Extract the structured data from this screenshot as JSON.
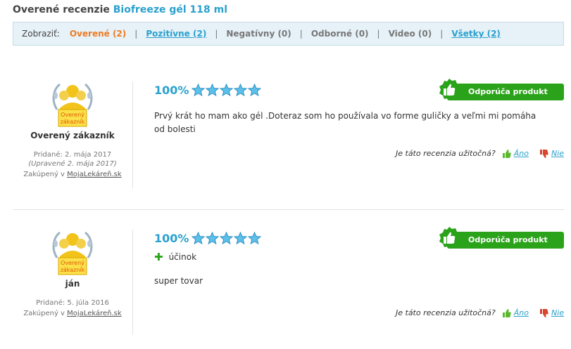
{
  "header": {
    "title_prefix": "Overené recenzie",
    "product_name": "Biofreeze gél 118 ml"
  },
  "filters": {
    "label": "Zobraziť:",
    "items": [
      {
        "label": "Overené (2)",
        "state": "active"
      },
      {
        "label": "Pozitívne (2)",
        "state": "link"
      },
      {
        "label": "Negatívny (0)",
        "state": "disabled"
      },
      {
        "label": "Odborné (0)",
        "state": "disabled"
      },
      {
        "label": "Video (0)",
        "state": "disabled"
      },
      {
        "label": "Všetky (2)",
        "state": "link"
      }
    ],
    "separator": "|"
  },
  "badge": {
    "line1": "Overený",
    "line2": "zákazník"
  },
  "reviews": [
    {
      "author": "Overený zákazník",
      "added": "Pridané: 2. mája 2017",
      "edited": "(Upravené 2. mája 2017)",
      "bought_prefix": "Zakúpený v",
      "store": "MojaLekáreň.sk",
      "score": "100%",
      "stars": 5,
      "recommend": "Odporúča produkt",
      "pros": [],
      "text": "Prvý krát ho mam ako gél .Doteraz som ho používala vo forme guličky a veľmi mi pomáha od bolesti",
      "helpful_question": "Je táto recenzia užitočná?",
      "yes": "Áno",
      "no": "Nie"
    },
    {
      "author": "ján",
      "added": "Pridané: 5. júla 2016",
      "edited": "",
      "bought_prefix": "Zakúpený v",
      "store": "MojaLekáreň.sk",
      "score": "100%",
      "stars": 5,
      "recommend": "Odporúča produkt",
      "pros": [
        "účinok"
      ],
      "text": "super tovar",
      "helpful_question": "Je táto recenzia užitočná?",
      "yes": "Áno",
      "no": "Nie"
    }
  ],
  "colors": {
    "accent_blue": "#2aa1cd",
    "active_orange": "#f07a22",
    "recommend_green": "#2aa31a",
    "badge_gold": "#f2c318"
  },
  "icons": {
    "star": "star-icon",
    "thumb_up": "thumbs-up-icon",
    "thumb_down": "thumbs-down-icon",
    "plus": "plus-icon",
    "badge": "verified-customer-badge"
  }
}
